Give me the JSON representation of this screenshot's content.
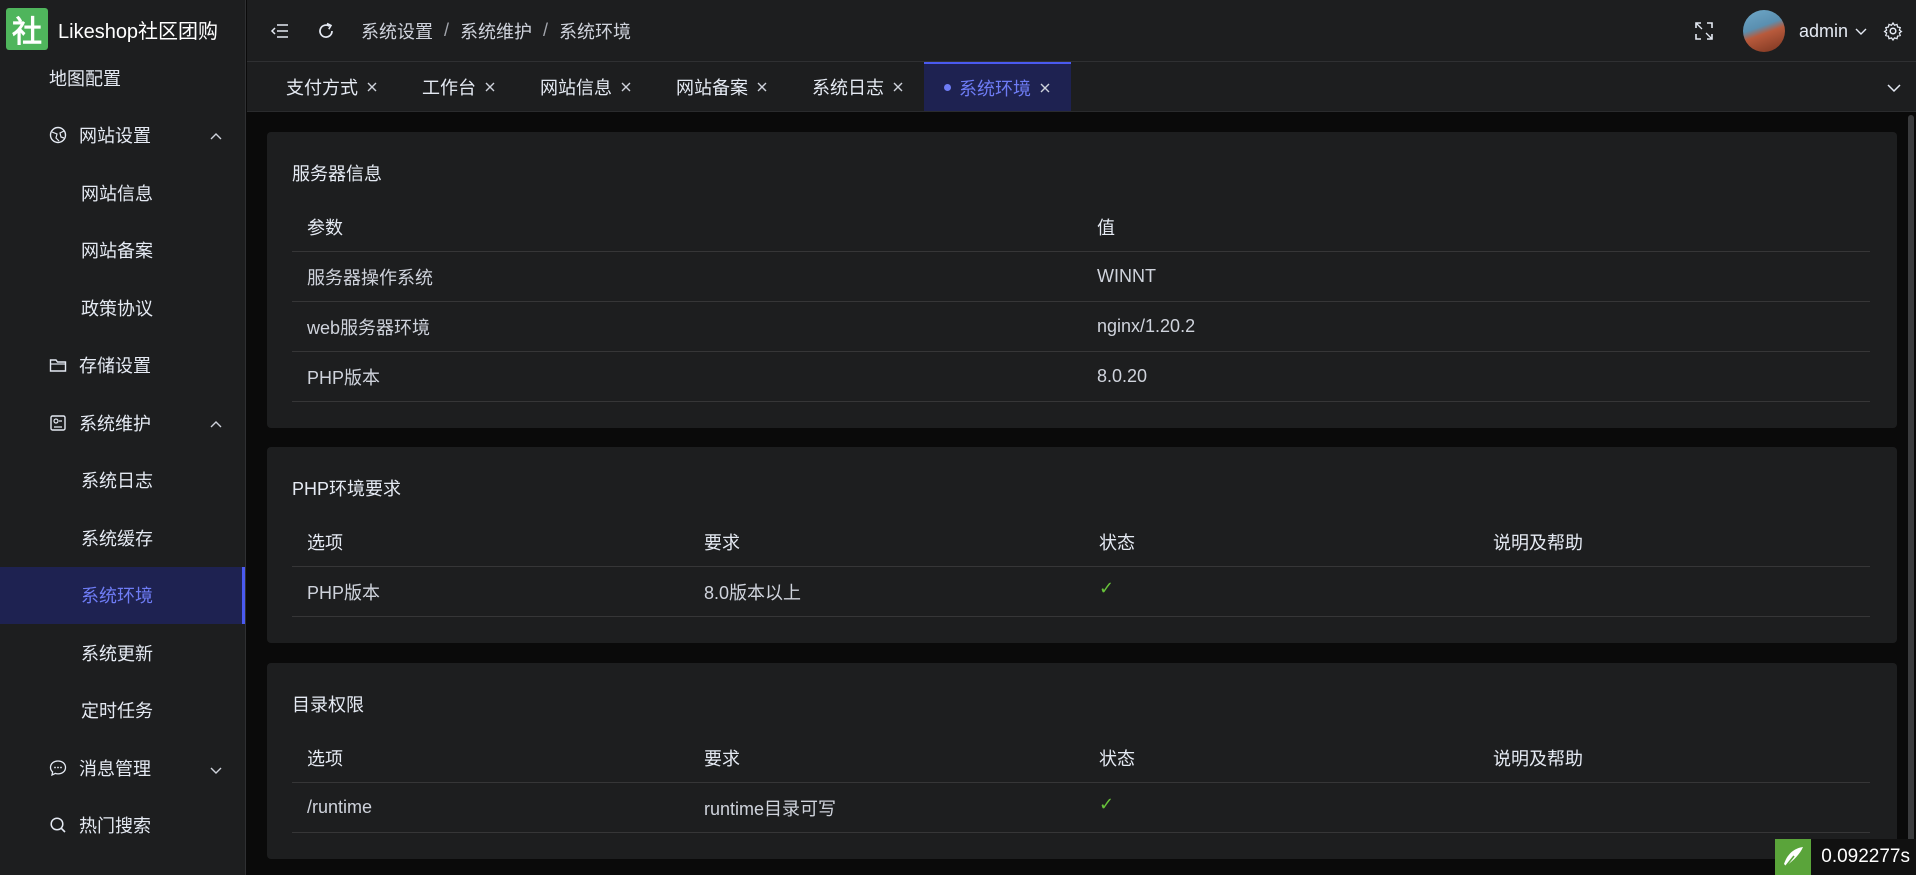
{
  "app": {
    "logo_char": "社",
    "title": "Likeshop社区团购"
  },
  "sidebar": {
    "items": [
      {
        "label": "地图配置"
      },
      {
        "label": "网站设置"
      },
      {
        "label": "网站信息"
      },
      {
        "label": "网站备案"
      },
      {
        "label": "政策协议"
      },
      {
        "label": "存储设置"
      },
      {
        "label": "系统维护"
      },
      {
        "label": "系统日志"
      },
      {
        "label": "系统缓存"
      },
      {
        "label": "系统环境"
      },
      {
        "label": "系统更新"
      },
      {
        "label": "定时任务"
      },
      {
        "label": "消息管理"
      },
      {
        "label": "热门搜索"
      }
    ]
  },
  "header": {
    "breadcrumb": [
      "系统设置",
      "系统维护",
      "系统环境"
    ],
    "separator": "/",
    "username": "admin"
  },
  "tabs": [
    {
      "label": "支付方式"
    },
    {
      "label": "工作台"
    },
    {
      "label": "网站信息"
    },
    {
      "label": "网站备案"
    },
    {
      "label": "系统日志"
    },
    {
      "label": "系统环境"
    }
  ],
  "server_info": {
    "title": "服务器信息",
    "headers": [
      "参数",
      "值"
    ],
    "rows": [
      [
        "服务器操作系统",
        "WINNT"
      ],
      [
        "web服务器环境",
        "nginx/1.20.2"
      ],
      [
        "PHP版本",
        "8.0.20"
      ]
    ]
  },
  "php_env": {
    "title": "PHP环境要求",
    "headers": [
      "选项",
      "要求",
      "状态",
      "说明及帮助"
    ],
    "rows": [
      [
        "PHP版本",
        "8.0版本以上",
        "✓",
        ""
      ]
    ]
  },
  "dir_perm": {
    "title": "目录权限",
    "headers": [
      "选项",
      "要求",
      "状态",
      "说明及帮助"
    ],
    "rows": [
      [
        "/runtime",
        "runtime目录可写",
        "✓",
        ""
      ]
    ]
  },
  "perf": {
    "time": "0.092277s"
  },
  "colors": {
    "accent": "#6e7cf5",
    "active_bg": "#1e2251",
    "success": "#67c23a",
    "logo_green": "#4fb55c"
  }
}
